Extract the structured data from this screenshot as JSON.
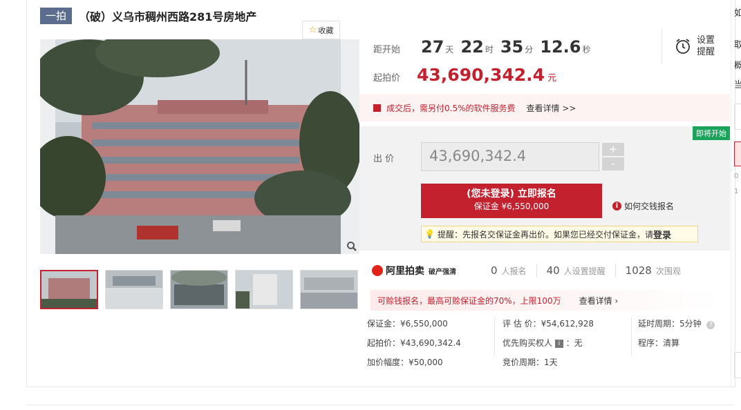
{
  "title": {
    "tag": "一拍",
    "text": "（破）义乌市稠州西路281号房地产"
  },
  "favorite": {
    "label": "收藏"
  },
  "countdown": {
    "label": "距开始",
    "days": "27",
    "days_unit": "天",
    "hours": "22",
    "hours_unit": "时",
    "minutes": "35",
    "minutes_unit": "分",
    "seconds": "12.6",
    "seconds_unit": "秒"
  },
  "reminder": {
    "line1": "设置",
    "line2": "提醒"
  },
  "start_price": {
    "label": "起拍价",
    "value": "43,690,342.4",
    "unit": "元"
  },
  "fee_notice": {
    "text": "成交后，需另付0.5%的软件服务费",
    "link": "查看详情 >>"
  },
  "bid": {
    "badge": "即将开始",
    "label": "出 价",
    "value": "43,690,342.4",
    "plus": "+",
    "minus": "-"
  },
  "signup": {
    "line1": "(您未登录) 立即报名",
    "line2": "保证金 ¥6,550,000"
  },
  "how_pay": {
    "icon_text": "i",
    "label": "如何交钱报名"
  },
  "tip": {
    "text": "提醒：先报名交保证金再出价。如果您已经交付保证金，请",
    "login": "登录"
  },
  "platform": {
    "name": "阿里拍卖",
    "sub": "破产强清"
  },
  "stats": [
    {
      "num": "0",
      "label": "人报名"
    },
    {
      "num": "40",
      "label": "人设置提醒"
    },
    {
      "num": "1028",
      "label": "次围观"
    }
  ],
  "refund_notice": {
    "text": "可赊钱报名，最高可赊保证金的70%，上限100万",
    "link": "查看详情 ›"
  },
  "details": {
    "col1": [
      "保证金：¥6,550,000",
      "起拍价：¥43,690,342.4",
      "加价幅度：¥50,000"
    ],
    "col2_a": "评 估 价：¥54,612,928",
    "col2_b_label": "优先购买权人",
    "col2_b_icon": "i",
    "col2_b_value": "：无",
    "col2_c": "竞价周期：1天",
    "col3_a": "延时周期：5分钟",
    "col3_b": "程序：清算"
  },
  "right_strip": [
    "如",
    "取",
    "概",
    "当",
    "0",
    "1"
  ]
}
